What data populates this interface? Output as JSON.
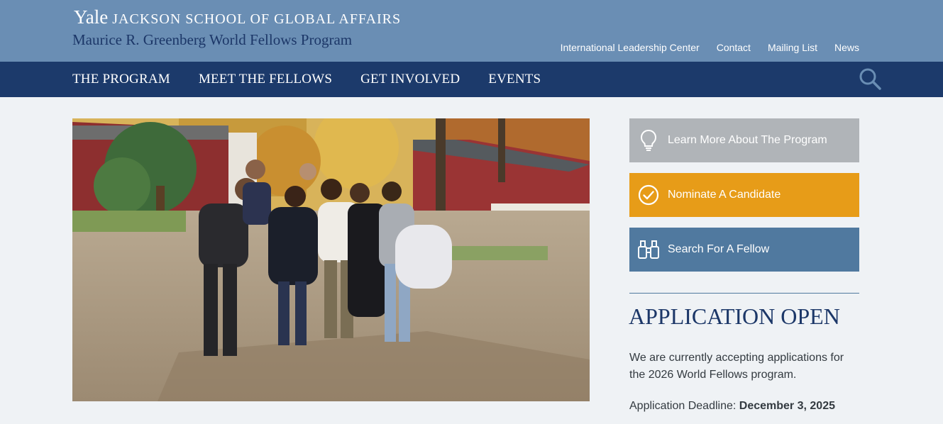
{
  "header": {
    "logo_yale": "Yale",
    "logo_school": "JACKSON SCHOOL OF GLOBAL AFFAIRS",
    "program_name": "Maurice R. Greenberg World Fellows Program",
    "utility_links": [
      "International Leadership Center",
      "Contact",
      "Mailing List",
      "News"
    ]
  },
  "nav": {
    "items": [
      "THE PROGRAM",
      "MEET THE FELLOWS",
      "GET INVOLVED",
      "EVENTS"
    ],
    "search_icon": "search-icon"
  },
  "hero": {
    "icon": "group-photo"
  },
  "sidebar": {
    "buttons": [
      {
        "label": "Learn More About The Program",
        "icon": "lightbulb-icon",
        "color": "#b0b4b8"
      },
      {
        "label": "Nominate A Candidate",
        "icon": "check-circle-icon",
        "color": "#e79c18"
      },
      {
        "label": "Search For A Fellow",
        "icon": "binoculars-icon",
        "color": "#50799f"
      }
    ],
    "application": {
      "heading": "APPLICATION OPEN",
      "body": "We are currently accepting applications for the 2026 World Fellows program.",
      "deadline_label": "Application Deadline:",
      "deadline_value": "December 3, 2025"
    }
  },
  "colors": {
    "header_bg": "#6a8eb4",
    "nav_bg": "#1c3a6b",
    "page_bg": "#eff2f5",
    "accent_navy": "#1c3768"
  }
}
